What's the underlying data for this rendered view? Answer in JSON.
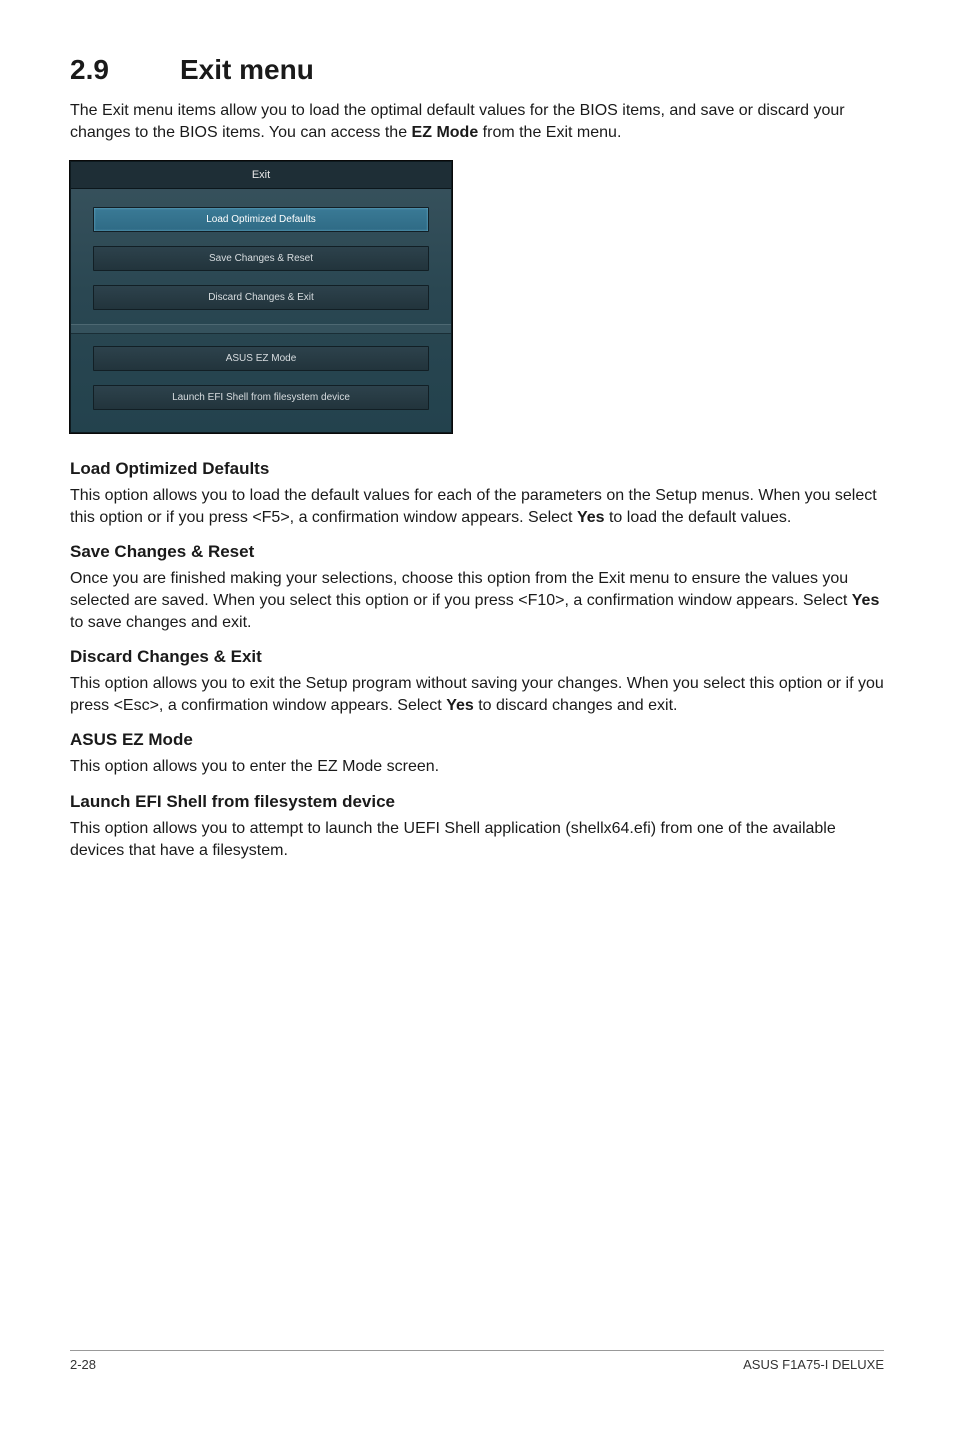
{
  "section": {
    "number": "2.9",
    "title": "Exit menu"
  },
  "intro": {
    "pre": "The Exit menu items allow you to load the optimal default values for the BIOS items, and save or discard your changes to the BIOS items. You can access the ",
    "bold": "EZ Mode",
    "post": " from the Exit menu."
  },
  "dialog": {
    "title": "Exit",
    "btn1": "Load Optimized Defaults",
    "btn2": "Save Changes & Reset",
    "btn3": "Discard Changes & Exit",
    "btn4": "ASUS EZ Mode",
    "btn5": "Launch EFI Shell from filesystem device"
  },
  "load_defaults": {
    "head": "Load Optimized Defaults",
    "p_pre": "This option allows you to load the default values for each of the parameters on the Setup menus. When you select this option or if you press <F5>, a confirmation window appears. Select ",
    "p_bold": "Yes",
    "p_post": " to load the default values."
  },
  "save_reset": {
    "head": "Save Changes & Reset",
    "p_pre": "Once you are finished making your selections, choose this option from the Exit menu to ensure the values you selected are saved. When you select this option or if you press <F10>, a confirmation window appears. Select ",
    "p_bold": "Yes",
    "p_post": " to save changes and exit."
  },
  "discard": {
    "head": "Discard Changes & Exit",
    "p_pre": "This option allows you to exit the Setup program without saving your changes. When you select this option or if you press <Esc>, a confirmation window appears. Select ",
    "p_bold": "Yes",
    "p_post": " to discard changes and exit."
  },
  "ezmode": {
    "head": "ASUS EZ Mode",
    "p": "This option allows you to enter the EZ Mode screen."
  },
  "efi": {
    "head": "Launch EFI Shell from filesystem device",
    "p": "This option allows you to attempt to launch the UEFI Shell application (shellx64.efi) from one of the available devices that have a filesystem."
  },
  "footer": {
    "left": "2-28",
    "right": "ASUS F1A75-I DELUXE"
  }
}
